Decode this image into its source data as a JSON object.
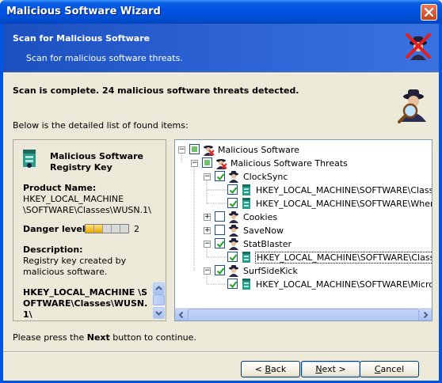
{
  "window": {
    "title": "Malicious Software Wizard"
  },
  "banner": {
    "title": "Scan for Malicious Software",
    "subtitle": "Scan for malicious software threats."
  },
  "status": "Scan is complete. 24 malicious software threats detected.",
  "list_label": "Below is the detailed list of found items:",
  "details": {
    "heading": "Malicious Software Registry Key",
    "product_name_label": "Product Name:",
    "product_name_value": "HKEY_LOCAL_MACHINE \\SOFTWARE\\Classes\\WUSN.1\\",
    "danger_label": "Danger level:",
    "danger_level": 2,
    "danger_max": 5,
    "description_label": "Description:",
    "description_value": "Registry key created by malicious software.",
    "registry_key": "HKEY_LOCAL_MACHINE \\SOFTWARE\\Classes\\WUSN. 1\\"
  },
  "tree": {
    "nodes": [
      {
        "label": "Malicious Software",
        "level": 0,
        "expander": "minus",
        "check": "partial",
        "icon": "spy-x-icon"
      },
      {
        "label": "Malicious Software Threats",
        "level": 1,
        "expander": "minus",
        "check": "partial",
        "icon": "spy-x-icon"
      },
      {
        "label": "ClockSync",
        "level": 2,
        "expander": "minus",
        "check": "checked",
        "icon": "spy-icon"
      },
      {
        "label": "HKEY_LOCAL_MACHINE\\SOFTWARE\\Classes\\",
        "level": 3,
        "expander": "",
        "check": "checked",
        "icon": "registry-icon"
      },
      {
        "label": "HKEY_LOCAL_MACHINE\\SOFTWARE\\WhenU\\",
        "level": 3,
        "expander": "",
        "check": "checked",
        "icon": "registry-icon"
      },
      {
        "label": "Cookies",
        "level": 2,
        "expander": "plus",
        "check": "unchecked",
        "icon": "spy-icon"
      },
      {
        "label": "SaveNow",
        "level": 2,
        "expander": "plus",
        "check": "unchecked",
        "icon": "spy-icon"
      },
      {
        "label": "StatBlaster",
        "level": 2,
        "expander": "minus",
        "check": "checked",
        "icon": "spy-icon"
      },
      {
        "label": "HKEY_LOCAL_MACHINE\\SOFTWARE\\Classes\\",
        "level": 3,
        "expander": "",
        "check": "checked",
        "icon": "registry-icon",
        "selected": true
      },
      {
        "label": "SurfSideKick",
        "level": 2,
        "expander": "minus",
        "check": "checked",
        "icon": "spy-icon"
      },
      {
        "label": "HKEY_LOCAL_MACHINE\\SOFTWARE\\Microsof",
        "level": 3,
        "expander": "",
        "check": "checked",
        "icon": "registry-icon"
      }
    ]
  },
  "hint": {
    "before": "Please press the ",
    "bold": "Next",
    "after": " button to continue."
  },
  "buttons": {
    "back": {
      "prefix": "< ",
      "mnemonic": "B",
      "rest": "ack"
    },
    "next": {
      "mnemonic": "N",
      "rest": "ext >"
    },
    "cancel": {
      "mnemonic": "C",
      "rest": "ancel"
    }
  },
  "colors": {
    "titlebar": "#0054e3",
    "banner": "#2c62d4",
    "check_green": "#21a121"
  }
}
